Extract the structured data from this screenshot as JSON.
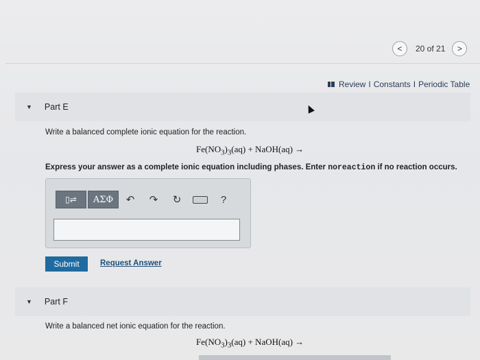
{
  "pager": {
    "prev": "<",
    "text": "20 of 21",
    "next": ">"
  },
  "links": {
    "review": "Review",
    "sep1": "I",
    "constants": "Constants",
    "sep2": "I",
    "periodic": "Periodic Table"
  },
  "partE": {
    "title": "Part E",
    "prompt": "Write a balanced complete ionic equation for the reaction.",
    "instruction_pre": "Express your answer as a complete ionic equation including phases. Enter ",
    "instruction_code": "noreaction",
    "instruction_post": " if no reaction occurs.",
    "toolbar": {
      "templates": "▯⇌",
      "greek": "ΑΣΦ",
      "undo": "↶",
      "redo": "↷",
      "reset": "↻",
      "help": "?"
    },
    "answer_value": "",
    "submit": "Submit",
    "request": "Request Answer"
  },
  "partF": {
    "title": "Part F",
    "prompt": "Write a balanced net ionic equation for the reaction."
  },
  "reaction": {
    "lhs1": "Fe(NO",
    "sub1": "3",
    "lhs2": ")",
    "sub2": "3",
    "lhs3": "(aq) + NaOH(aq) →"
  }
}
